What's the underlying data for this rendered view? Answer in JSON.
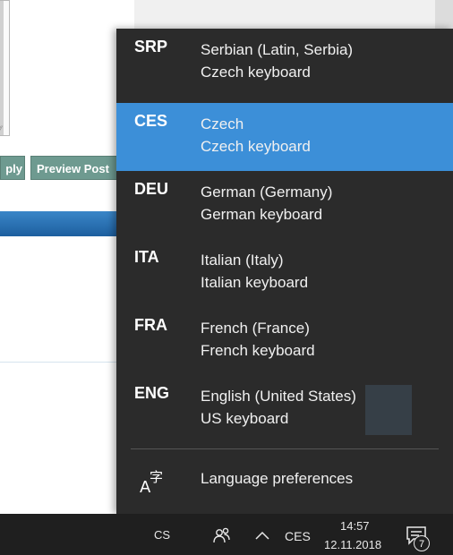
{
  "background": {
    "reply_label": "ply",
    "preview_label": "Preview Post"
  },
  "language_flyout": {
    "items": [
      {
        "code": "SRP",
        "name": "Serbian (Latin, Serbia)",
        "keyboard": "Czech keyboard",
        "selected": false
      },
      {
        "code": "CES",
        "name": "Czech",
        "keyboard": "Czech keyboard",
        "selected": true
      },
      {
        "code": "DEU",
        "name": "German (Germany)",
        "keyboard": "German keyboard",
        "selected": false
      },
      {
        "code": "ITA",
        "name": "Italian (Italy)",
        "keyboard": "Italian keyboard",
        "selected": false
      },
      {
        "code": "FRA",
        "name": "French (France)",
        "keyboard": "French keyboard",
        "selected": false
      },
      {
        "code": "ENG",
        "name": "English (United States)",
        "keyboard": "US keyboard",
        "selected": false
      }
    ],
    "preferences_label": "Language preferences",
    "preferences_icon": "language-icon",
    "selected_color": "#3c8fd8"
  },
  "taskbar": {
    "keyboard_indicator": "CS",
    "input_language": "CES",
    "time": "14:57",
    "date": "12.11.2018",
    "notification_count": "7"
  }
}
